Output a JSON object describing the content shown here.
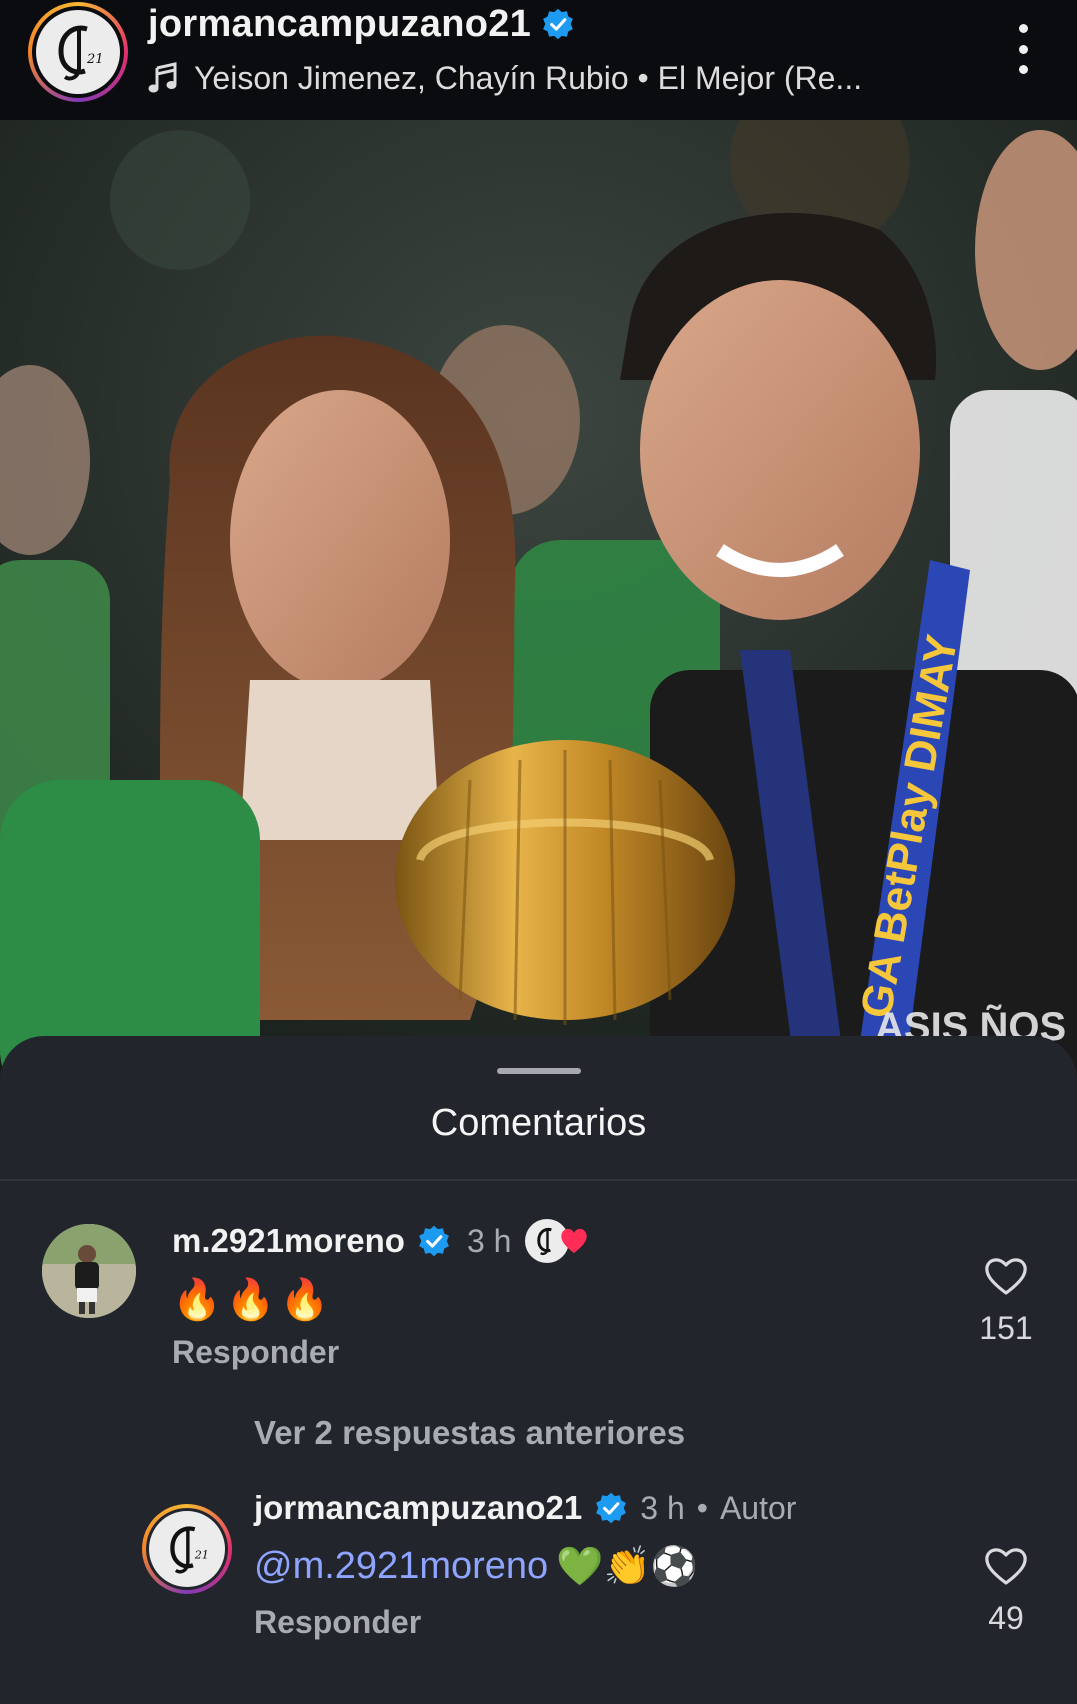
{
  "header": {
    "username": "jormancampuzano21",
    "music": "Yeison Jimenez, Chayín Rubio • El Mejor (Re..."
  },
  "colors": {
    "verified": "#1d9bf0",
    "sheet_bg": "#22252b",
    "mention": "#8ea4ff",
    "secondary_text": "#a8abb0"
  },
  "photo": {
    "description_hidden": true,
    "jersey_text": "ASIS ÑOS",
    "lanyard_text": "GA BetPlay DIMAY"
  },
  "comments_sheet": {
    "title": "Comentarios",
    "comments": [
      {
        "username": "m.2921moreno",
        "time": "3 h",
        "text": "🔥🔥🔥",
        "reply_label": "Responder",
        "likes": "151",
        "liked_by_author": true
      }
    ],
    "view_replies_label": "Ver 2 respuestas anteriores",
    "replies": [
      {
        "username": "jormancampuzano21",
        "time": "3 h",
        "badge": "Autor",
        "mention": "@m.2921moreno",
        "text_emojis": "💚👏⚽",
        "reply_label": "Responder",
        "likes": "49"
      }
    ]
  },
  "icons": {
    "verified": "verified-badge-icon",
    "music": "music-note-icon",
    "more": "more-options-icon",
    "heart": "heart-outline-icon"
  }
}
